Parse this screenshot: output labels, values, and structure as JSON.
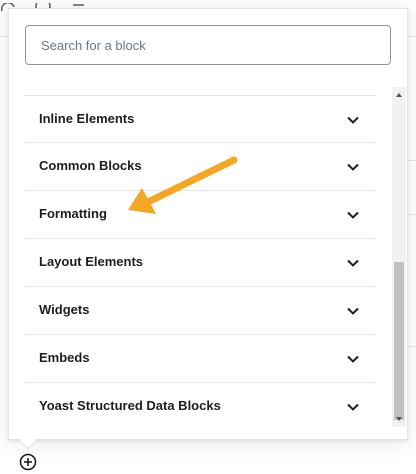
{
  "background": {
    "toolbar_icons": [
      "redo-icon",
      "info-icon",
      "list-view-icon"
    ]
  },
  "inserter": {
    "search": {
      "placeholder": "Search for a block",
      "value": ""
    },
    "panels": [
      {
        "label": "Inline Elements",
        "icon": "chevron-down-icon"
      },
      {
        "label": "Common Blocks",
        "icon": "chevron-down-icon"
      },
      {
        "label": "Formatting",
        "icon": "chevron-down-icon"
      },
      {
        "label": "Layout Elements",
        "icon": "chevron-down-icon"
      },
      {
        "label": "Widgets",
        "icon": "chevron-down-icon"
      },
      {
        "label": "Embeds",
        "icon": "chevron-down-icon"
      },
      {
        "label": "Yoast Structured Data Blocks",
        "icon": "chevron-down-icon"
      }
    ],
    "scroll_position": 0.6
  },
  "annotation": {
    "color": "#f5a623",
    "points_to": "Formatting"
  },
  "footer": {
    "add_block_icon": "plus-circle-icon"
  },
  "colors": {
    "text": "#1e1e1e",
    "border": "#e2e4e7",
    "placeholder": "#6c7781",
    "arrow": "#f5a623"
  }
}
